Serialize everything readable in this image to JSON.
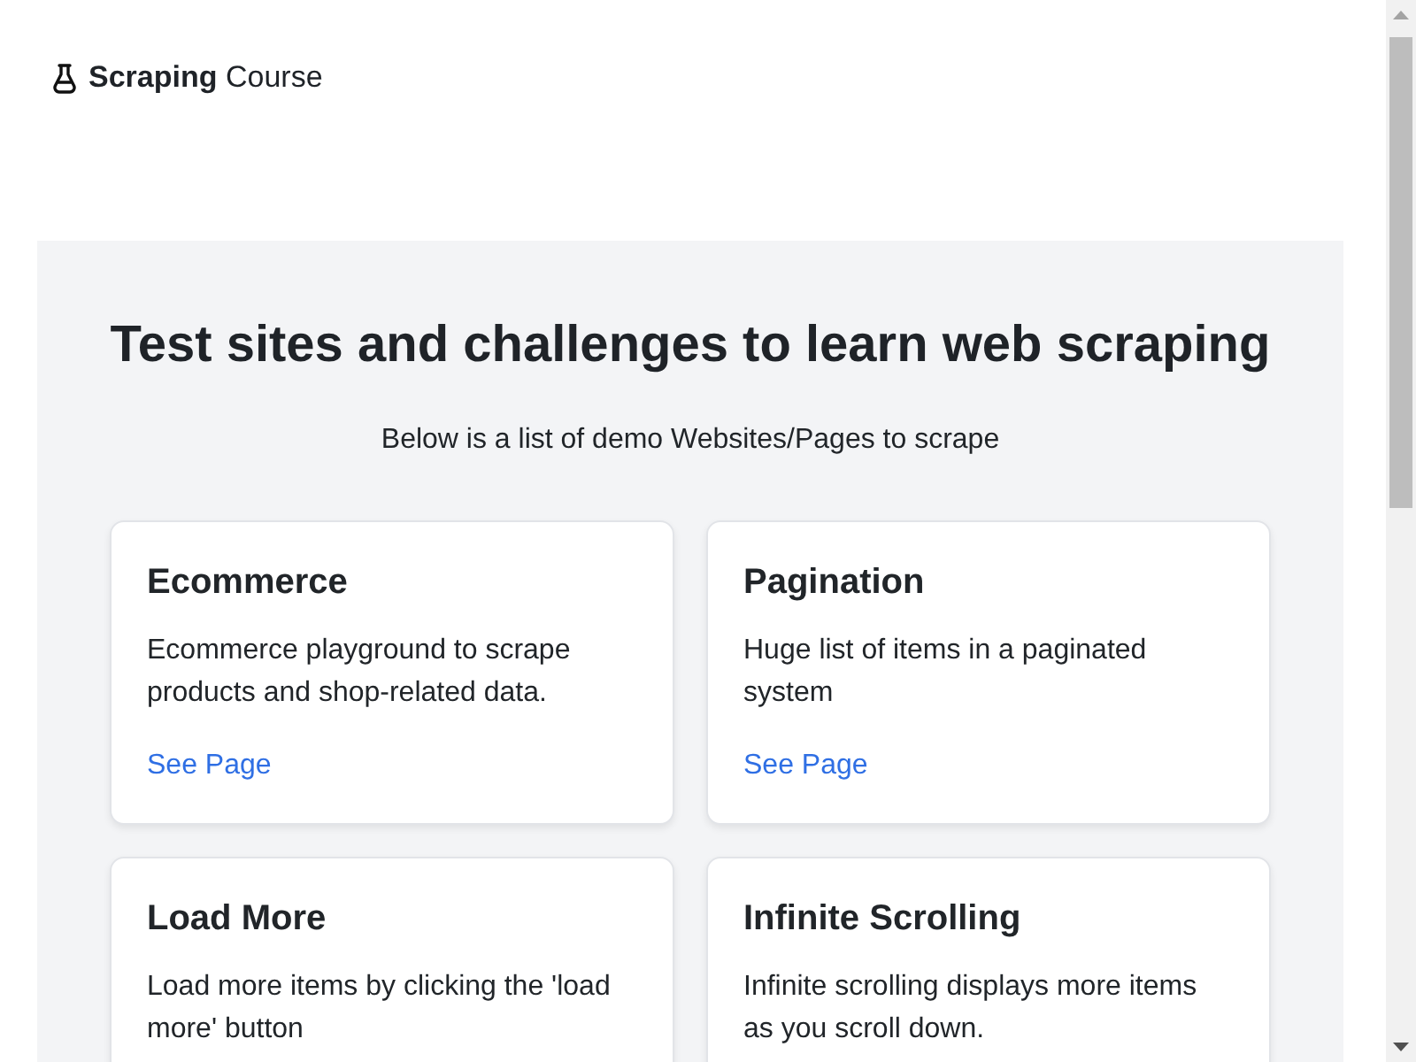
{
  "header": {
    "logo": "**Scraping** Course"
  },
  "hero": {
    "title": "Test sites and challenges to learn web scraping",
    "subtitle": "Below is a list of demo Websites/Pages to scrape"
  },
  "cards": [
    {
      "title": "Ecommerce",
      "description": "Ecommerce playground to scrape products and shop-related data.",
      "link": "See Page"
    },
    {
      "title": "Pagination",
      "description": "Huge list of items in a paginated system",
      "link": "See Page"
    },
    {
      "title": "Load More",
      "description": "Load more items by clicking the 'load more' button"
    },
    {
      "title": "Infinite Scrolling",
      "description": "Infinite scrolling displays more items as you scroll down."
    }
  ]
}
